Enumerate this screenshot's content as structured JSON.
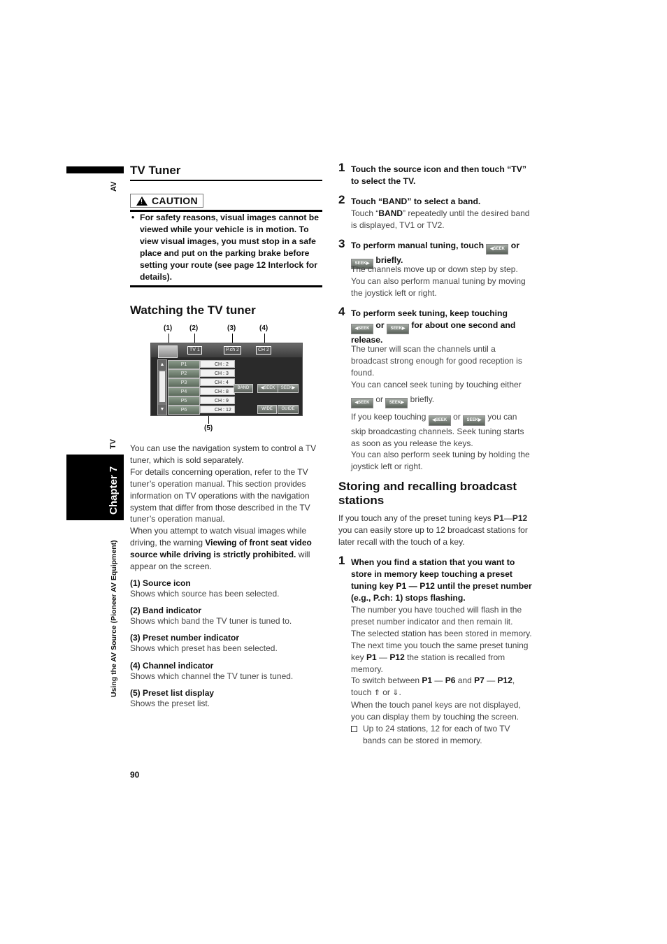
{
  "side": {
    "av": "AV",
    "tv": "TV",
    "chapter": "Chapter 7",
    "section": "Using the AV Source (Pioneer AV Equipment)"
  },
  "tv_tuner": {
    "title": "TV Tuner",
    "caution_label": "CAUTION",
    "caution_text": "For safety reasons, visual images cannot be viewed while your vehicle is in motion. To view visual images, you must stop in a safe place and put on the parking brake before setting your route (see page 12 Interlock for details)."
  },
  "watching": {
    "title": "Watching the TV tuner",
    "figure": {
      "callouts": [
        "(1)",
        "(2)",
        "(3)",
        "(4)",
        "(5)"
      ],
      "band": "TV 1",
      "preset": "P.ch 2",
      "channel": "CH 2",
      "presets": [
        {
          "key": "P1",
          "ch": "CH : 2"
        },
        {
          "key": "P2",
          "ch": "CH : 3"
        },
        {
          "key": "P3",
          "ch": "CH : 4"
        },
        {
          "key": "P4",
          "ch": "CH : 8"
        },
        {
          "key": "P5",
          "ch": "CH : 9"
        },
        {
          "key": "P6",
          "ch": "CH : 12"
        }
      ],
      "buttons": {
        "band": "BAND",
        "seek_left": "◀SEEK",
        "seek_right": "SEEK▶",
        "wide": "WIDE",
        "guide": "GUIDE"
      }
    },
    "intro_1": "You can use the navigation system to control a TV tuner, which is sold separately.",
    "intro_2": "For details concerning operation, refer to the TV tuner’s operation manual. This section provides information on TV operations with the navigation system that differ from those described in the TV tuner’s operation manual.",
    "intro_3a": "When you attempt to watch visual images while driving, the warning ",
    "intro_3b": "Viewing of front seat video source while driving is strictly prohibited.",
    "intro_3c": " will appear on the screen.",
    "definitions": [
      {
        "term": "(1) Source icon",
        "desc": "Shows which source has been selected."
      },
      {
        "term": "(2) Band indicator",
        "desc": "Shows which band the TV tuner is tuned to."
      },
      {
        "term": "(3) Preset number indicator",
        "desc": "Shows which preset has been selected."
      },
      {
        "term": "(4) Channel indicator",
        "desc": "Shows which channel the TV tuner is tuned."
      },
      {
        "term": "(5) Preset list display",
        "desc": "Shows the preset list."
      }
    ]
  },
  "steps": [
    {
      "num": "1",
      "head": "Touch the source icon and then touch “TV” to select the TV."
    },
    {
      "num": "2",
      "head": "Touch “BAND” to select a band.",
      "body_a": "Touch “",
      "body_b": "BAND",
      "body_c": "” repeatedly until the desired band is displayed, TV1 or TV2."
    },
    {
      "num": "3",
      "head_a": "To perform manual tuning, touch ",
      "head_b": " or ",
      "head_c": " briefly.",
      "body": "The channels move up or down step by step. You can also perform manual tuning by moving the joystick left or right."
    },
    {
      "num": "4",
      "head_a": "To perform seek tuning, keep touching ",
      "head_b": " or ",
      "head_c": " for about one second and release.",
      "body_1": "The tuner will scan the channels until a broadcast strong enough for good reception is found.",
      "body_2": "You can cancel seek tuning by touching either",
      "body_3a": " or ",
      "body_3b": " briefly.",
      "body_4a": "If you keep touching ",
      "body_4b": " or ",
      "body_4c": " you can skip broadcasting channels. Seek tuning starts as soon as you release the keys.",
      "body_5": "You can also perform seek tuning by holding the joystick left or right."
    }
  ],
  "seek_left_label": "◀SEEK",
  "seek_right_label": "SEEK▶",
  "storing": {
    "title": "Storing and recalling broadcast stations",
    "intro_a": "If you touch any of the preset tuning keys ",
    "p1": "P1",
    "dash": "—",
    "p12": "P12",
    "intro_b": " you can easily store up to 12 broadcast stations for later recall with the touch of a key.",
    "step_num": "1",
    "step_head": "When you find a station that you want to store in memory keep touching a preset tuning key P1 — P12 until the preset number (e.g., P.ch: 1) stops flashing.",
    "body_1": "The number you have touched will flash in the preset number indicator and then remain lit.",
    "body_2": "The selected station has been stored in memory.",
    "body_3a": "The next time you touch the same preset tuning key ",
    "body_3b": " the station is recalled from memory.",
    "body_4a": "To switch between ",
    "p6": "P6",
    "and": " and ",
    "p7": "P7",
    "body_4b": ", touch ",
    "up_glyph": "⇑",
    "or": " or ",
    "down_glyph": "⇓",
    "body_5": "When the touch panel keys are not displayed, you can display them by touching the screen.",
    "note": "Up to 24 stations, 12 for each of two TV bands can be stored in memory."
  },
  "page_number": "90"
}
